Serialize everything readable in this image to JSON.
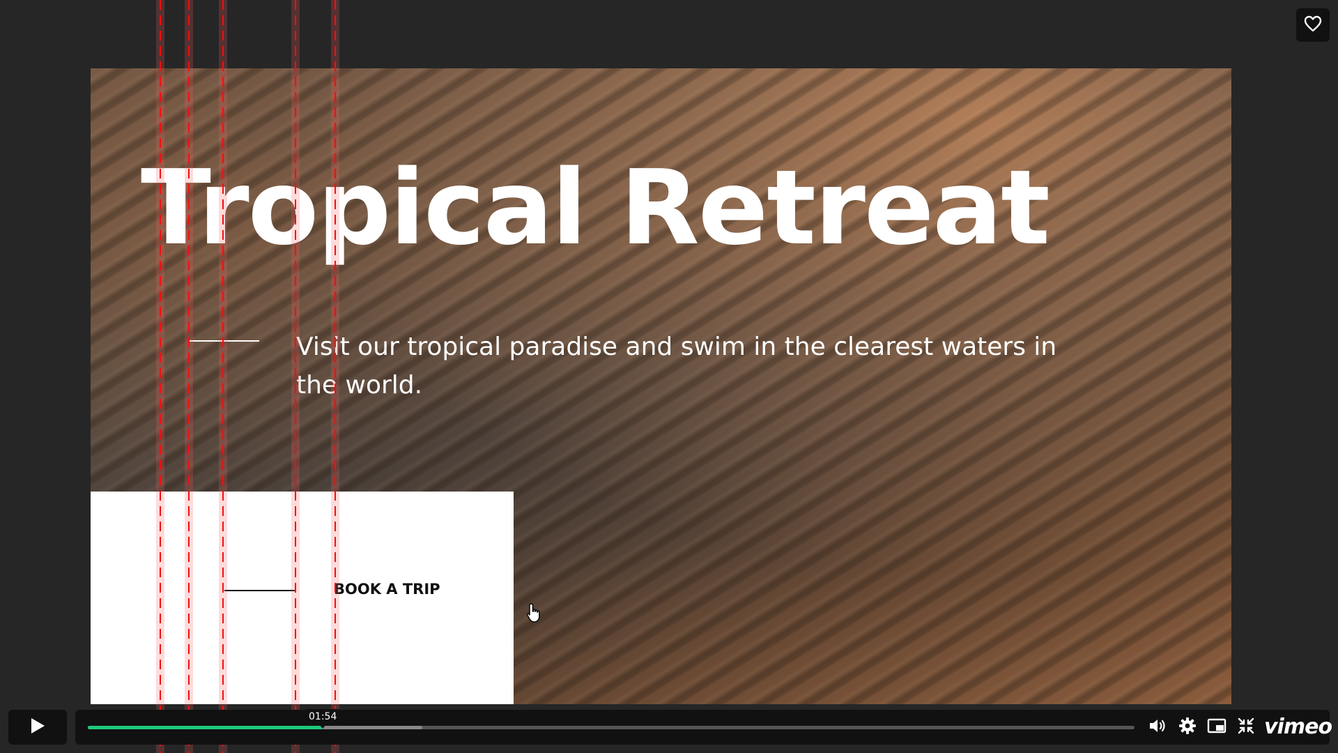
{
  "slide": {
    "title": "Tropical Retreat",
    "description": "Visit our tropical paradise and swim in the clearest waters in the world.",
    "cta_label": "BOOK A TRIP"
  },
  "player": {
    "tooltip_time": "01:54",
    "played_fraction": 0.2245,
    "buffered_fraction": 0.3195,
    "brand": "vimeo",
    "colors": {
      "progress": "#1dc97a",
      "buffered": "#888888",
      "track": "#555555",
      "bar": "#111111"
    }
  },
  "icons": {
    "like": "heart-icon",
    "play": "play-icon",
    "volume": "volume-icon",
    "settings": "gear-icon",
    "pip": "picture-in-picture-icon",
    "fullscreen": "exit-fullscreen-icon",
    "cursor": "hand-pointer-cursor-icon"
  }
}
